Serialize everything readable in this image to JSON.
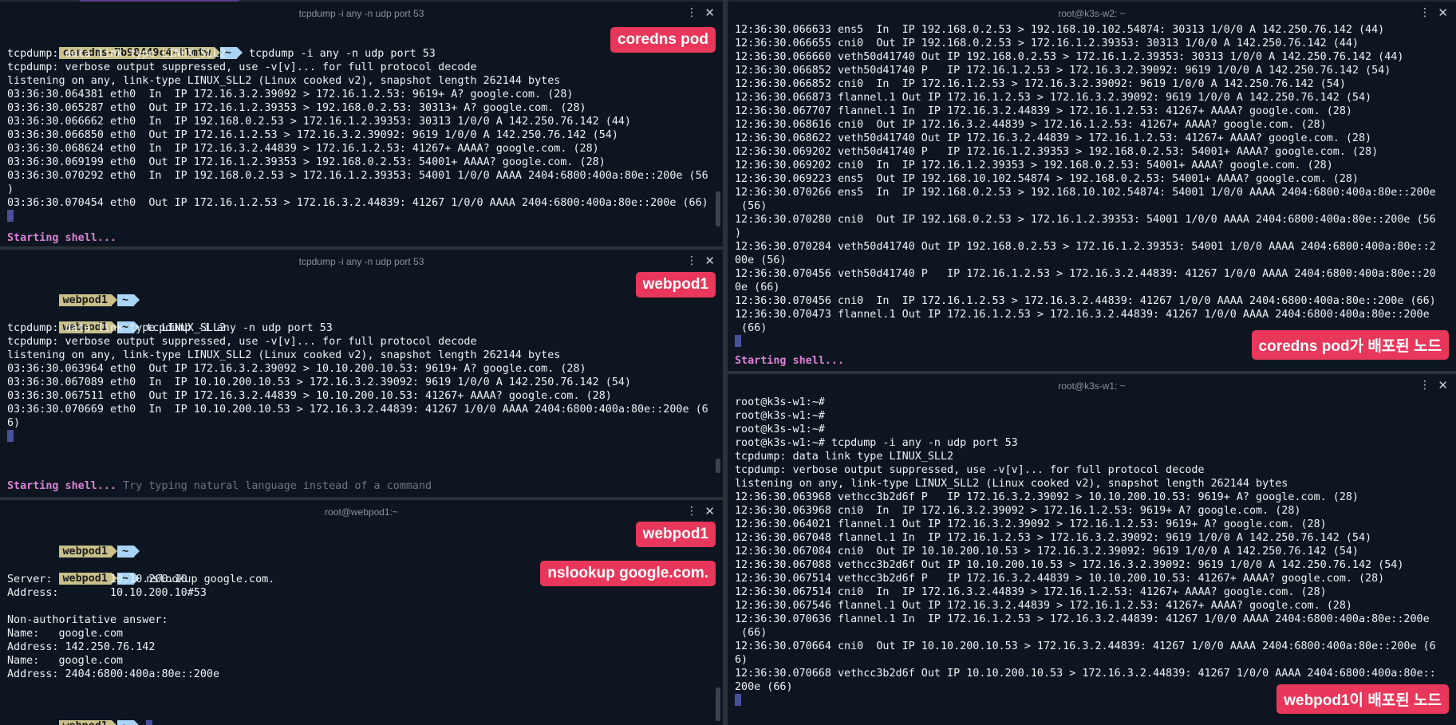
{
  "p1": {
    "title": "tcpdump -i any -n udp port 53",
    "prompt_name": "coredns-7b98449c4-tlmtw",
    "prompt_dir": "~",
    "command": "tcpdump -i any -n udp port 53",
    "lines": [
      "tcpdump: data link type LINUX_SLL2",
      "tcpdump: verbose output suppressed, use -v[v]... for full protocol decode",
      "listening on any, link-type LINUX_SLL2 (Linux cooked v2), snapshot length 262144 bytes",
      "03:36:30.064381 eth0  In  IP 172.16.3.2.39092 > 172.16.1.2.53: 9619+ A? google.com. (28)",
      "03:36:30.065287 eth0  Out IP 172.16.1.2.39353 > 192.168.0.2.53: 30313+ A? google.com. (28)",
      "03:36:30.066662 eth0  In  IP 192.168.0.2.53 > 172.16.1.2.39353: 30313 1/0/0 A 142.250.76.142 (44)",
      "03:36:30.066850 eth0  Out IP 172.16.1.2.53 > 172.16.3.2.39092: 9619 1/0/0 A 142.250.76.142 (54)",
      "03:36:30.068624 eth0  In  IP 172.16.3.2.44839 > 172.16.1.2.53: 41267+ AAAA? google.com. (28)",
      "03:36:30.069199 eth0  Out IP 172.16.1.2.39353 > 192.168.0.2.53: 54001+ AAAA? google.com. (28)",
      "03:36:30.070292 eth0  In  IP 192.168.0.2.53 > 172.16.1.2.39353: 54001 1/0/0 AAAA 2404:6800:400a:80e::200e (56",
      ")",
      "03:36:30.070454 eth0  Out IP 172.16.1.2.53 > 172.16.3.2.44839: 41267 1/0/0 AAAA 2404:6800:400a:80e::200e (66)"
    ],
    "starting": "Starting shell...",
    "tag": "coredns pod"
  },
  "p2": {
    "title": "tcpdump -i any -n udp port 53",
    "prompt_name": "webpod1",
    "prompt_dir": "~",
    "command": "tcpdump -i any -n udp port 53",
    "lines": [
      "tcpdump: data link type LINUX_SLL2",
      "tcpdump: verbose output suppressed, use -v[v]... for full protocol decode",
      "listening on any, link-type LINUX_SLL2 (Linux cooked v2), snapshot length 262144 bytes",
      "03:36:30.063964 eth0  Out IP 172.16.3.2.39092 > 10.10.200.10.53: 9619+ A? google.com. (28)",
      "03:36:30.067089 eth0  In  IP 10.10.200.10.53 > 172.16.3.2.39092: 9619 1/0/0 A 142.250.76.142 (54)",
      "03:36:30.067511 eth0  Out IP 172.16.3.2.44839 > 10.10.200.10.53: 41267+ AAAA? google.com. (28)",
      "03:36:30.070669 eth0  In  IP 10.10.200.10.53 > 172.16.3.2.44839: 41267 1/0/0 AAAA 2404:6800:400a:80e::200e (6",
      "6)"
    ],
    "starting": "Starting shell...",
    "hint": "Try typing natural language instead of a command",
    "tag": "webpod1"
  },
  "p3": {
    "title": "root@webpod1:~",
    "prompt_name": "webpod1",
    "prompt_dir": "~",
    "command": "nslookup google.com.",
    "lines": [
      "Server:         10.10.200.10",
      "Address:        10.10.200.10#53",
      "",
      "Non-authoritative answer:",
      "Name:   google.com",
      "Address: 142.250.76.142",
      "Name:   google.com",
      "Address: 2404:6800:400a:80e::200e"
    ],
    "tag1": "webpod1",
    "tag2": "nslookup google.com."
  },
  "p4": {
    "title": "root@k3s-w2: ~",
    "lines": [
      "12:36:30.066633 ens5  In  IP 192.168.0.2.53 > 192.168.10.102.54874: 30313 1/0/0 A 142.250.76.142 (44)",
      "12:36:30.066655 cni0  Out IP 192.168.0.2.53 > 172.16.1.2.39353: 30313 1/0/0 A 142.250.76.142 (44)",
      "12:36:30.066660 veth50d41740 Out IP 192.168.0.2.53 > 172.16.1.2.39353: 30313 1/0/0 A 142.250.76.142 (44)",
      "12:36:30.066852 veth50d41740 P   IP 172.16.1.2.53 > 172.16.3.2.39092: 9619 1/0/0 A 142.250.76.142 (54)",
      "12:36:30.066852 cni0  In  IP 172.16.1.2.53 > 172.16.3.2.39092: 9619 1/0/0 A 142.250.76.142 (54)",
      "12:36:30.066873 flannel.1 Out IP 172.16.1.2.53 > 172.16.3.2.39092: 9619 1/0/0 A 142.250.76.142 (54)",
      "12:36:30.067707 flannel.1 In  IP 172.16.3.2.44839 > 172.16.1.2.53: 41267+ AAAA? google.com. (28)",
      "12:36:30.068616 cni0  Out IP 172.16.3.2.44839 > 172.16.1.2.53: 41267+ AAAA? google.com. (28)",
      "12:36:30.068622 veth50d41740 Out IP 172.16.3.2.44839 > 172.16.1.2.53: 41267+ AAAA? google.com. (28)",
      "12:36:30.069202 veth50d41740 P   IP 172.16.1.2.39353 > 192.168.0.2.53: 54001+ AAAA? google.com. (28)",
      "12:36:30.069202 cni0  In  IP 172.16.1.2.39353 > 192.168.0.2.53: 54001+ AAAA? google.com. (28)",
      "12:36:30.069223 ens5  Out IP 192.168.10.102.54874 > 192.168.0.2.53: 54001+ AAAA? google.com. (28)",
      "12:36:30.070266 ens5  In  IP 192.168.0.2.53 > 192.168.10.102.54874: 54001 1/0/0 AAAA 2404:6800:400a:80e::200e",
      " (56)",
      "12:36:30.070280 cni0  Out IP 192.168.0.2.53 > 172.16.1.2.39353: 54001 1/0/0 AAAA 2404:6800:400a:80e::200e (56",
      ")",
      "12:36:30.070284 veth50d41740 Out IP 192.168.0.2.53 > 172.16.1.2.39353: 54001 1/0/0 AAAA 2404:6800:400a:80e::2",
      "00e (56)",
      "12:36:30.070456 veth50d41740 P   IP 172.16.1.2.53 > 172.16.3.2.44839: 41267 1/0/0 AAAA 2404:6800:400a:80e::20",
      "0e (66)",
      "12:36:30.070456 cni0  In  IP 172.16.1.2.53 > 172.16.3.2.44839: 41267 1/0/0 AAAA 2404:6800:400a:80e::200e (66)",
      "12:36:30.070473 flannel.1 Out IP 172.16.1.2.53 > 172.16.3.2.44839: 41267 1/0/0 AAAA 2404:6800:400a:80e::200e",
      " (66)"
    ],
    "starting": "Starting shell...",
    "tag": "coredns pod가 배포된 노드"
  },
  "p5": {
    "title": "root@k3s-w1: ~",
    "lines": [
      "root@k3s-w1:~#",
      "root@k3s-w1:~#",
      "root@k3s-w1:~#",
      "root@k3s-w1:~# tcpdump -i any -n udp port 53",
      "tcpdump: data link type LINUX_SLL2",
      "tcpdump: verbose output suppressed, use -v[v]... for full protocol decode",
      "listening on any, link-type LINUX_SLL2 (Linux cooked v2), snapshot length 262144 bytes",
      "12:36:30.063968 vethcc3b2d6f P   IP 172.16.3.2.39092 > 10.10.200.10.53: 9619+ A? google.com. (28)",
      "12:36:30.063968 cni0  In  IP 172.16.3.2.39092 > 172.16.1.2.53: 9619+ A? google.com. (28)",
      "12:36:30.064021 flannel.1 Out IP 172.16.3.2.39092 > 172.16.1.2.53: 9619+ A? google.com. (28)",
      "12:36:30.067048 flannel.1 In  IP 172.16.1.2.53 > 172.16.3.2.39092: 9619 1/0/0 A 142.250.76.142 (54)",
      "12:36:30.067084 cni0  Out IP 10.10.200.10.53 > 172.16.3.2.39092: 9619 1/0/0 A 142.250.76.142 (54)",
      "12:36:30.067088 vethcc3b2d6f Out IP 10.10.200.10.53 > 172.16.3.2.39092: 9619 1/0/0 A 142.250.76.142 (54)",
      "12:36:30.067514 vethcc3b2d6f P   IP 172.16.3.2.44839 > 10.10.200.10.53: 41267+ AAAA? google.com. (28)",
      "12:36:30.067514 cni0  In  IP 172.16.3.2.44839 > 172.16.1.2.53: 41267+ AAAA? google.com. (28)",
      "12:36:30.067546 flannel.1 Out IP 172.16.3.2.44839 > 172.16.1.2.53: 41267+ AAAA? google.com. (28)",
      "12:36:30.070636 flannel.1 In  IP 172.16.1.2.53 > 172.16.3.2.44839: 41267 1/0/0 AAAA 2404:6800:400a:80e::200e",
      " (66)",
      "12:36:30.070664 cni0  Out IP 10.10.200.10.53 > 172.16.3.2.44839: 41267 1/0/0 AAAA 2404:6800:400a:80e::200e (6",
      "6)",
      "12:36:30.070668 vethcc3b2d6f Out IP 10.10.200.10.53 > 172.16.3.2.44839: 41267 1/0/0 AAAA 2404:6800:400a:80e::",
      "200e (66)"
    ],
    "tag": "webpod1이 배포된 노드"
  }
}
